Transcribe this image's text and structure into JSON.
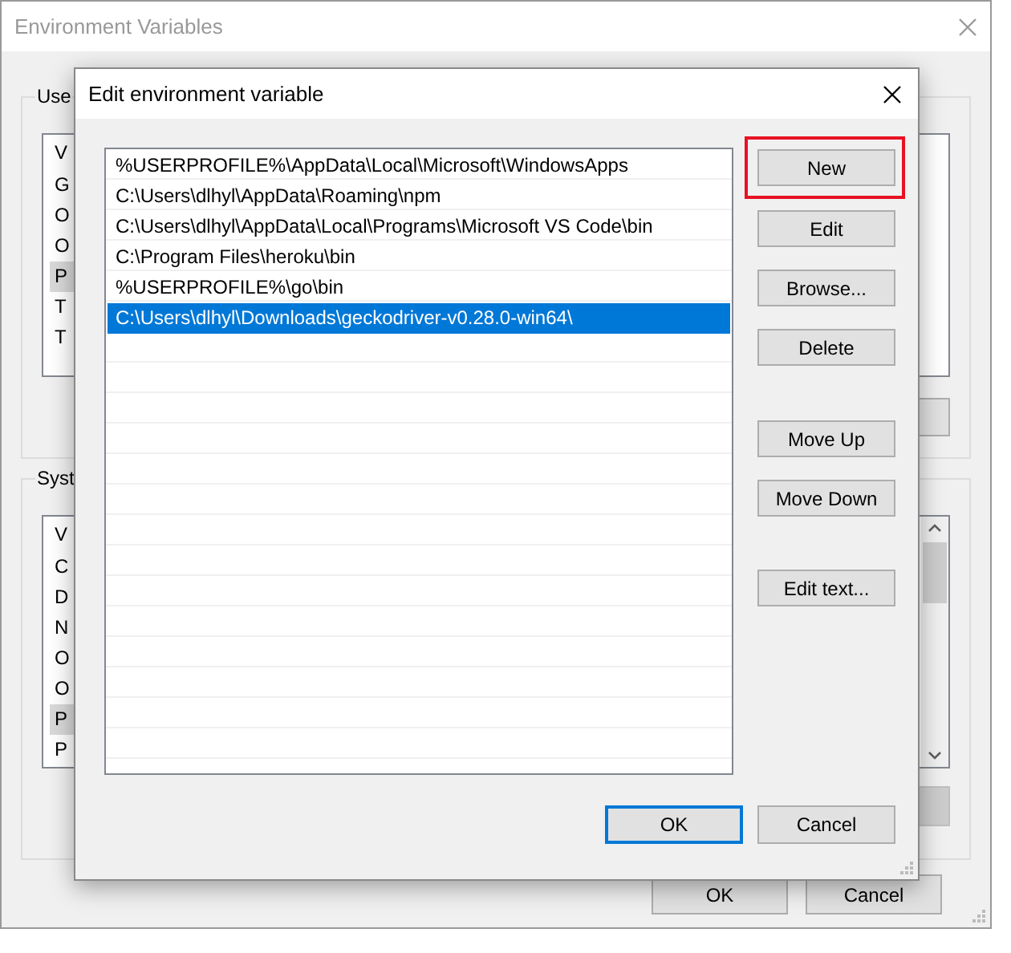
{
  "background_window": {
    "title": "Environment Variables",
    "user_group": {
      "label": "Use",
      "header": "V",
      "rows": [
        {
          "text": "G",
          "selected": false
        },
        {
          "text": "O",
          "selected": false
        },
        {
          "text": "O",
          "selected": false
        },
        {
          "text": "P",
          "selected": true
        },
        {
          "text": "T",
          "selected": false
        },
        {
          "text": "T",
          "selected": false
        }
      ]
    },
    "system_group": {
      "label": "Syst",
      "header": "V",
      "rows": [
        {
          "text": "C",
          "selected": false
        },
        {
          "text": "D",
          "selected": false
        },
        {
          "text": "N",
          "selected": false
        },
        {
          "text": "O",
          "selected": false
        },
        {
          "text": "O",
          "selected": false
        },
        {
          "text": "P",
          "selected": true
        },
        {
          "text": "P",
          "selected": false
        }
      ]
    },
    "buttons": [
      "OK",
      "Cancel"
    ]
  },
  "dialog": {
    "title": "Edit environment variable",
    "entries": [
      {
        "text": "%USERPROFILE%\\AppData\\Local\\Microsoft\\WindowsApps",
        "selected": false
      },
      {
        "text": "C:\\Users\\dlhyl\\AppData\\Roaming\\npm",
        "selected": false
      },
      {
        "text": "C:\\Users\\dlhyl\\AppData\\Local\\Programs\\Microsoft VS Code\\bin",
        "selected": false
      },
      {
        "text": "C:\\Program Files\\heroku\\bin",
        "selected": false
      },
      {
        "text": "%USERPROFILE%\\go\\bin",
        "selected": false
      },
      {
        "text": "C:\\Users\\dlhyl\\Downloads\\geckodriver-v0.28.0-win64\\",
        "selected": true
      }
    ],
    "buttons": [
      {
        "label": "New",
        "annotated": true
      },
      {
        "label": "Edit",
        "annotated": false
      },
      {
        "label": "Browse...",
        "annotated": false
      },
      {
        "label": "Delete",
        "annotated": false
      },
      {
        "label": "Move Up",
        "annotated": false
      },
      {
        "label": "Move Down",
        "annotated": false
      },
      {
        "label": "Edit text...",
        "annotated": false
      }
    ],
    "footer_buttons": [
      {
        "label": "OK",
        "default": true
      },
      {
        "label": "Cancel",
        "default": false
      }
    ]
  }
}
